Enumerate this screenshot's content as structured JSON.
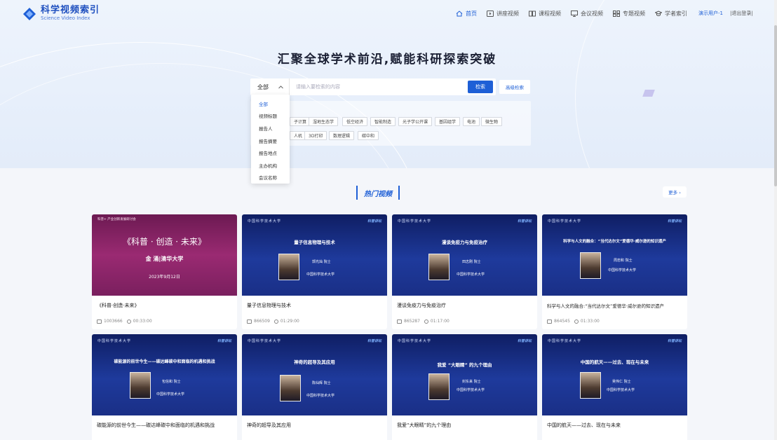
{
  "header": {
    "logo_title": "科学视频索引",
    "logo_sub": "Science Video Index",
    "nav": [
      {
        "label": "首页",
        "icon": "home-icon",
        "active": true
      },
      {
        "label": "讲座视频",
        "icon": "play-icon",
        "active": false
      },
      {
        "label": "课程视频",
        "icon": "book-icon",
        "active": false
      },
      {
        "label": "会议视频",
        "icon": "monitor-icon",
        "active": false
      },
      {
        "label": "专题视频",
        "icon": "grid-icon",
        "active": false
      },
      {
        "label": "学者索引",
        "icon": "scholar-icon",
        "active": false
      }
    ],
    "user": "演示用户-1",
    "logout": "|退出登录|"
  },
  "hero": {
    "slogan": "汇聚全球学术前沿,赋能科研探索突破"
  },
  "search": {
    "category": "全部",
    "placeholder": "请输入要检索的内容",
    "button": "检索",
    "advanced": "高级检索"
  },
  "tags": [
    "子计算",
    "湿地生态学",
    "低空经济",
    "智能制造",
    "光子学公开课",
    "基因组学",
    "电池",
    "微生物",
    "人机",
    "3D打印",
    "数理逻辑",
    "碳中和"
  ],
  "dropdown": [
    "全部",
    "视频标题",
    "报告人",
    "报告摘要",
    "报告地点",
    "主办机构",
    "会议名称"
  ],
  "section": {
    "title": "热门视频",
    "more": "更多 ›"
  },
  "videos": [
    {
      "title": "《科普·创造·未来》",
      "views": "1003666",
      "duration": "00:33:00",
      "thumb_top": "科普+ 产业创新发展研讨会",
      "thumb_main": "《科普 · 创造 · 未来》",
      "thumb_speaker": "金 涌|清华大学",
      "thumb_date": "2023年9月12日"
    },
    {
      "title": "量子信息物理与技术",
      "views": "866509",
      "duration": "01:29:00",
      "thumb_title": "量子信息物理与技术",
      "speaker": "郭光灿 院士",
      "inst": "中国科学技术大学"
    },
    {
      "title": "漫谈免疫力与免疫治疗",
      "views": "865287",
      "duration": "01:17:00",
      "thumb_title": "漫谈免疫力与免疫治疗",
      "speaker": "田志刚 院士",
      "inst": "中国科学技术大学"
    },
    {
      "title": "科学与人文的融合:“当代达尔文”爱德华·威尔逊的知识遗产",
      "views": "864545",
      "duration": "01:33:00",
      "thumb_title": "科学与人文的融合：“当代达尔文”爱德华·威尔逊的知识遗产",
      "speaker": "周忠和 院士",
      "inst": "中国科学技术大学"
    },
    {
      "title": "碳能源的前世今生——碳达峰碳中和面临的机遇和挑战",
      "views": "",
      "duration": "",
      "thumb_title": "碳能源的前世今生——碳达峰碳中和面临的机遇和挑战",
      "speaker": "包信和 院士",
      "inst": "中国科学技术大学"
    },
    {
      "title": "神奇的超导及其应用",
      "views": "",
      "duration": "",
      "thumb_title": "神奇的超导及其应用",
      "speaker": "陈仙辉 院士",
      "inst": "中国科学技术大学"
    },
    {
      "title": "我爱“大眼睛”的九个理由",
      "views": "",
      "duration": "",
      "thumb_title": "我爱 “大眼睛” 的九个理由",
      "speaker": "封东来 院士",
      "inst": "中国科学技术大学"
    },
    {
      "title": "中国的航天——过去、现在与未来",
      "views": "",
      "duration": "",
      "thumb_title": "中国的航天——过去、现在与未来",
      "speaker": "吴伟仁 院士",
      "inst": "中国科学技术大学"
    }
  ],
  "thumb_org": "中国科学技术大学",
  "thumb_brand": "科普讲坛"
}
